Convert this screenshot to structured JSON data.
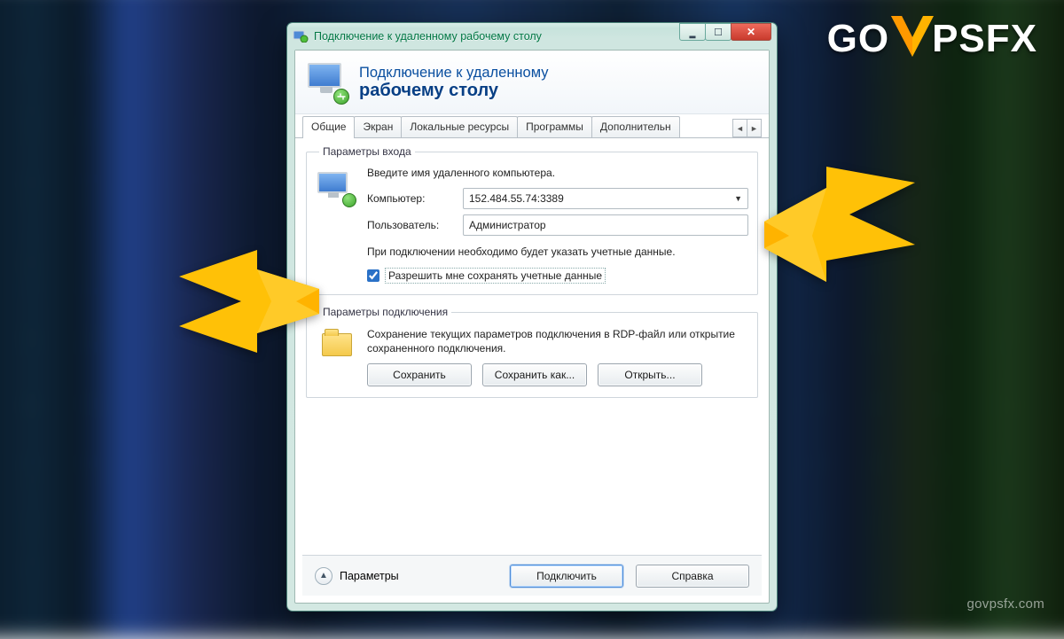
{
  "brand": {
    "left": "GO",
    "right": "PSFX"
  },
  "watermark": "govpsfx.com",
  "window": {
    "title": "Подключение к удаленному рабочему столу",
    "header_line1": "Подключение к удаленному",
    "header_line2": "рабочему столу"
  },
  "tabs": {
    "items": [
      "Общие",
      "Экран",
      "Локальные ресурсы",
      "Программы",
      "Дополнительн"
    ],
    "active_index": 0,
    "scroll_left": "◄",
    "scroll_right": "►"
  },
  "login_group": {
    "legend": "Параметры входа",
    "hint": "Введите имя удаленного компьютера.",
    "computer_label": "Компьютер:",
    "computer_value": "152.484.55.74:3389",
    "user_label": "Пользователь:",
    "user_value": "Администратор",
    "note": "При подключении необходимо будет указать учетные данные.",
    "checkbox_label": "Разрешить мне сохранять учетные данные",
    "checkbox_checked": true
  },
  "conn_group": {
    "legend": "Параметры подключения",
    "desc": "Сохранение текущих параметров подключения в RDP-файл или открытие сохраненного подключения.",
    "save": "Сохранить",
    "save_as": "Сохранить как...",
    "open": "Открыть..."
  },
  "footer": {
    "collapse_glyph": "▲",
    "label": "Параметры",
    "connect": "Подключить",
    "help": "Справка"
  }
}
